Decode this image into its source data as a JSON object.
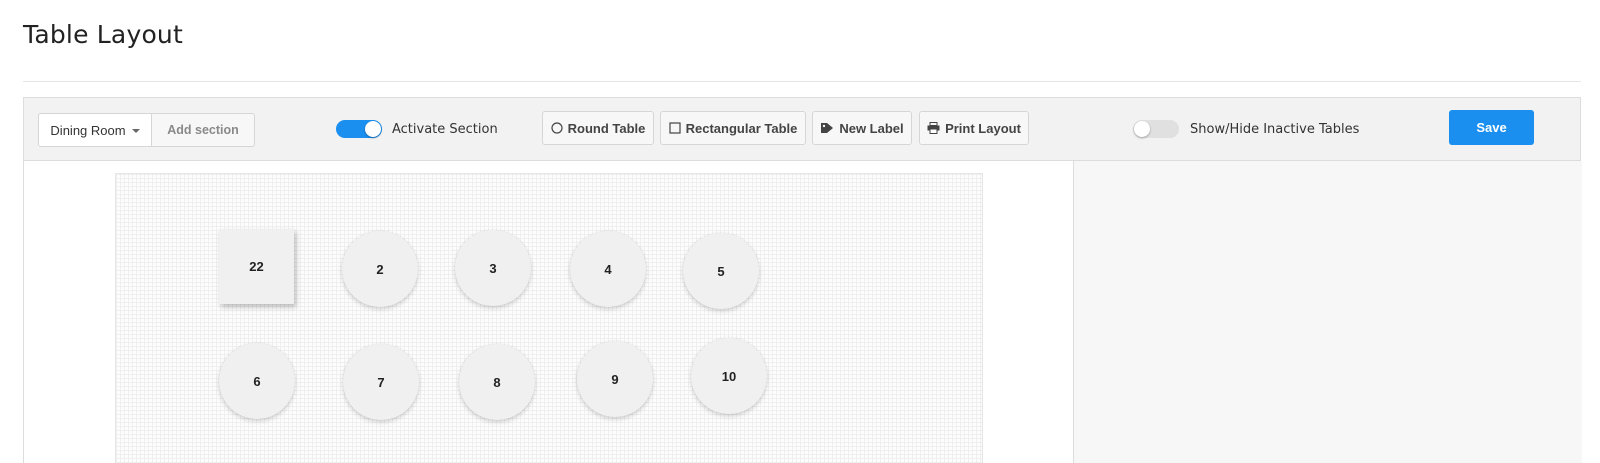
{
  "page": {
    "title": "Table Layout"
  },
  "toolbar": {
    "section_select": "Dining Room",
    "add_section": "Add section",
    "activate_section": {
      "label": "Activate Section",
      "on": true
    },
    "round_table": "Round Table",
    "rect_table": "Rectangular Table",
    "new_label": "New Label",
    "print_layout": "Print Layout",
    "show_hide_inactive": {
      "label": "Show/Hide Inactive Tables",
      "on": false
    },
    "save": "Save"
  },
  "colors": {
    "accent": "#1a8ff0",
    "toolbar_bg": "#f2f2f2",
    "panel_bg": "#f7f7f7"
  },
  "tables": [
    {
      "label": "22",
      "shape": "rectangular"
    },
    {
      "label": "2",
      "shape": "round"
    },
    {
      "label": "3",
      "shape": "round"
    },
    {
      "label": "4",
      "shape": "round"
    },
    {
      "label": "5",
      "shape": "round"
    },
    {
      "label": "6",
      "shape": "round"
    },
    {
      "label": "7",
      "shape": "round"
    },
    {
      "label": "8",
      "shape": "round"
    },
    {
      "label": "9",
      "shape": "round"
    },
    {
      "label": "10",
      "shape": "round"
    }
  ]
}
